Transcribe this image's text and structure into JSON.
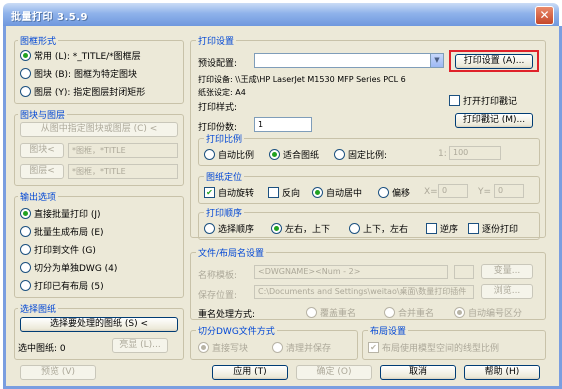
{
  "title": "批量打印 3.5.9",
  "frame_shape": {
    "legend": "图框形式",
    "options": [
      {
        "label": "常用 (L): *_TITLE/*图框层",
        "selected": true
      },
      {
        "label": "图块 (B): 图框为特定图块",
        "selected": false
      },
      {
        "label": "图层 (Y): 指定图层封闭矩形",
        "selected": false
      }
    ]
  },
  "block_layer": {
    "legend": "图块与图层",
    "pick_button": "从图中指定图块或图层 (C) <",
    "block_button": "图块<",
    "block_value": "*图框，*TITLE",
    "layer_button": "图层<",
    "layer_value": "*图框，*TITLE"
  },
  "output": {
    "legend": "输出选项",
    "options": [
      {
        "label": "直接批量打印 (J)",
        "selected": true
      },
      {
        "label": "批量生成布局 (E)",
        "selected": false
      },
      {
        "label": "打印到文件 (G)",
        "selected": false
      },
      {
        "label": "切分为单独DWG (4)",
        "selected": false
      },
      {
        "label": "打印已有布局 (5)",
        "selected": false
      }
    ]
  },
  "select": {
    "legend": "选择图纸",
    "select_button": "选择要处理的图纸 (S) <",
    "selected_label": "选中图纸: 0",
    "highlight_button": "亮显 (L)..."
  },
  "print_settings": {
    "legend": "打印设置",
    "preset_label": "预设配置:",
    "preset_value": "",
    "setup_button": "打印设置 (A)...",
    "printer_line": "打印设备: \\\\王成\\HP LaserJet M1530 MFP Series PCL 6",
    "paper_line": "纸张设定: A4",
    "style_label": "打印样式:",
    "stamp_checkbox": "打开打印戳记",
    "copies_label": "打印份数:",
    "copies_value": "1",
    "stamp_button": "打印戳记 (M)..."
  },
  "scale": {
    "legend": "打印比例",
    "options": [
      {
        "label": "自动比例",
        "selected": false
      },
      {
        "label": "适合图纸",
        "selected": true
      },
      {
        "label": "固定比例:",
        "selected": false
      }
    ],
    "ratio_label": "1:",
    "ratio_value": "100"
  },
  "position": {
    "legend": "图纸定位",
    "auto_rotate": {
      "label": "自动旋转",
      "checked": true
    },
    "reverse": {
      "label": "反向",
      "checked": false
    },
    "options": [
      {
        "label": "自动居中",
        "selected": true
      },
      {
        "label": "偏移",
        "selected": false
      }
    ],
    "x_label": "X=",
    "x_value": "0",
    "y_label": "Y=",
    "y_value": "0"
  },
  "order": {
    "legend": "打印顺序",
    "options": [
      {
        "label": "选择顺序",
        "selected": false
      },
      {
        "label": "左右，上下",
        "selected": true
      },
      {
        "label": "上下，左右",
        "selected": false
      }
    ],
    "reverse": {
      "label": "逆序",
      "checked": false
    },
    "each": {
      "label": "逐份打印",
      "checked": false
    }
  },
  "file_layout": {
    "legend": "文件/布局名设置",
    "name_label": "名称模板:",
    "name_value": "<DWGNAME><Num - 2>",
    "var_button": "变量...",
    "path_label": "保存位置:",
    "path_value": "C:\\Documents and Settings\\weitao\\桌面\\数量打印插件",
    "browse_button": "浏览...",
    "rename_label": "重名处理方式:",
    "rename_options": [
      {
        "label": "覆盖重名",
        "selected": false
      },
      {
        "label": "合并重名",
        "selected": false
      },
      {
        "label": "自动编号区分",
        "selected": true
      }
    ]
  },
  "dwg_split": {
    "legend": "切分DWG文件方式",
    "options": [
      {
        "label": "直接写块",
        "selected": true
      },
      {
        "label": "清理并保存",
        "selected": false
      }
    ]
  },
  "layout_settings": {
    "legend": "布局设置",
    "checkbox": {
      "label": "布局使用模型空间的线型比例",
      "checked": true
    }
  },
  "buttons": {
    "preview": "预览 (V)",
    "apply": "应用 (T)",
    "ok": "确定 (O)",
    "cancel": "取消",
    "help": "帮助 (H)"
  }
}
